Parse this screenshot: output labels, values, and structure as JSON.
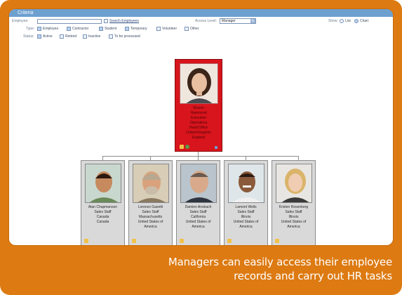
{
  "criteria": {
    "title": "Criteria",
    "employee_label": "Employee:",
    "search_label": "Search Employees",
    "manager_label": "Access Level:",
    "manager_value": "Manager",
    "show_label": "Show:",
    "show_options": [
      {
        "label": "List",
        "checked": false
      },
      {
        "label": "Chart",
        "checked": true
      }
    ],
    "type_label": "Type:",
    "type_options": [
      {
        "label": "Employee",
        "checked": true
      },
      {
        "label": "Contractor",
        "checked": true
      },
      {
        "label": "Student",
        "checked": true
      },
      {
        "label": "Temporary",
        "checked": true
      },
      {
        "label": "Volunteer",
        "checked": false
      },
      {
        "label": "Other",
        "checked": false
      }
    ],
    "status_label": "Status:",
    "status_options": [
      {
        "label": "Active",
        "checked": true
      },
      {
        "label": "Retired",
        "checked": false
      },
      {
        "label": "Inactive",
        "checked": false
      },
      {
        "label": "To be processed",
        "checked": false
      }
    ]
  },
  "manager": {
    "lines": [
      "Sharon",
      "Hammond",
      "Executive",
      "Operations",
      "Head Office",
      "United Kingdom",
      "England"
    ]
  },
  "employees": [
    {
      "lines": [
        "Alan Chapmanson",
        "Sales Staff",
        "Canada",
        "Canada"
      ]
    },
    {
      "lines": [
        "Lorenzo Gazetti",
        "Sales Staff",
        "Massachusetts",
        "United States of",
        "America"
      ]
    },
    {
      "lines": [
        "Damien Ansbach",
        "Sales Staff",
        "California",
        "United States of",
        "America"
      ]
    },
    {
      "lines": [
        "Lamont Wells",
        "Sales Staff",
        "Illinois",
        "United States of",
        "America"
      ]
    },
    {
      "lines": [
        "Kristen Rosenberg",
        "Sales Staff",
        "Illinois",
        "United States of",
        "America"
      ]
    }
  ],
  "caption": {
    "line1": "Managers can easily access their employee",
    "line2": "records and carry out HR tasks"
  },
  "colors": {
    "frame": "#dd7a12",
    "criteria_bar": "#6d9fcf",
    "manager_card": "#d8141c",
    "employee_card": "#d9d9d9"
  }
}
